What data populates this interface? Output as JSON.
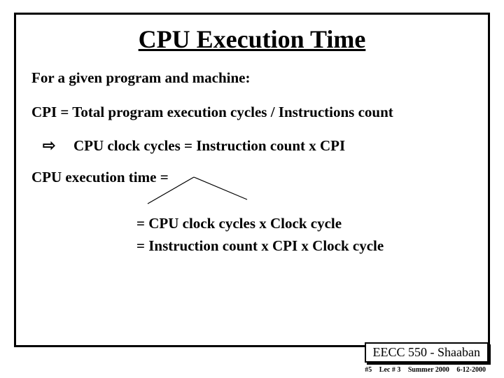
{
  "title": "CPU Execution Time",
  "intro": "For a given program and machine:",
  "cpi_line": "CPI =  Total program execution cycles / Instructions count",
  "arrow_glyph": "⇨",
  "arrow_line": "CPU clock cycles  =   Instruction count  x  CPI",
  "exec_line": "CPU execution time  =",
  "eq1": "=  CPU clock cycles  x   Clock cycle",
  "eq2": "= Instruction count  x  CPI  x  Clock cycle",
  "footer_course": "EECC 550 - Shaaban",
  "footer_sub": {
    "pg": "#5",
    "lec": "Lec # 3",
    "term": "Summer 2000",
    "date": "6-12-2000"
  }
}
